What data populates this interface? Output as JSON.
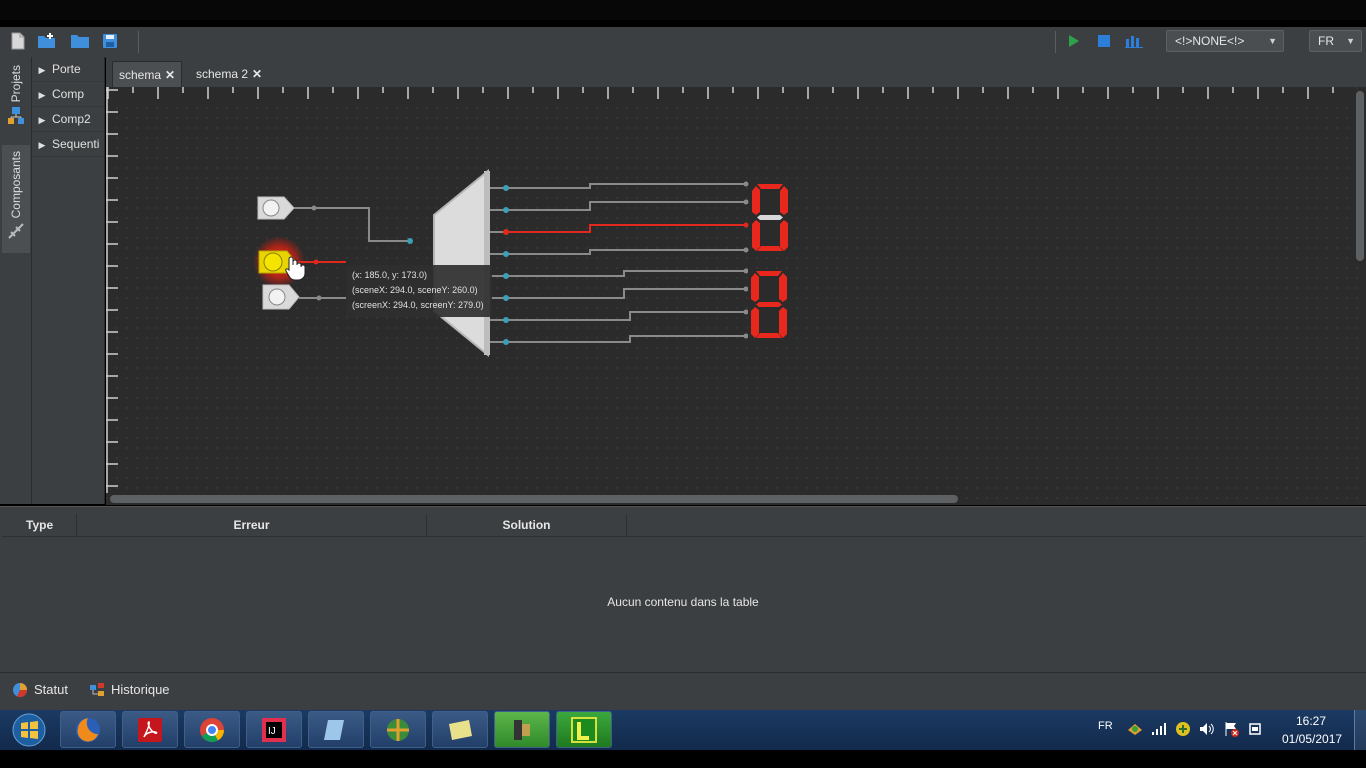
{
  "toolbar": {
    "combo_value": "<!>NONE<!>",
    "lang_value": "FR",
    "colors": {
      "play": "#2ca24a",
      "stop": "#2c7fd8",
      "chart": "#2c7fd8"
    }
  },
  "sidebar": {
    "tabs": [
      {
        "label": "Projets",
        "icon": "project-icon"
      },
      {
        "label": "Composants",
        "icon": "components-icon"
      }
    ],
    "tree": [
      {
        "label": "Porte"
      },
      {
        "label": "Comp"
      },
      {
        "label": "Comp2"
      },
      {
        "label": "Sequenti"
      }
    ]
  },
  "editor": {
    "tabs": [
      {
        "label": "schema",
        "close": "✕"
      },
      {
        "label": "schema 2",
        "close": "✕"
      }
    ],
    "tooltip": {
      "line1": "(x: 185.0, y: 173.0)",
      "line2": "(sceneX: 294.0, sceneY: 260.0)",
      "line3": "(screenX: 294.0, screenY: 279.0)"
    },
    "colors": {
      "wire": "#8a8a8a",
      "active_wire": "#e0281e",
      "segment": "#e8281c",
      "pin": "#3aa0b8"
    }
  },
  "errors": {
    "columns": [
      "Type",
      "Erreur",
      "Solution"
    ],
    "empty_message": "Aucun contenu dans la table"
  },
  "status": {
    "tabs": [
      {
        "label": "Statut",
        "icon": "pie-chart-icon"
      },
      {
        "label": "Historique",
        "icon": "history-icon"
      }
    ]
  },
  "taskbar": {
    "apps": [
      "windows-start-icon",
      "firefox-icon",
      "acrobat-icon",
      "chrome-icon",
      "intellij-icon",
      "notepad-icon",
      "network-icon",
      "sticky-notes-icon",
      "tool-icon",
      "logisim-icon"
    ],
    "lang": "FR",
    "time": "16:27",
    "date": "01/05/2017"
  }
}
